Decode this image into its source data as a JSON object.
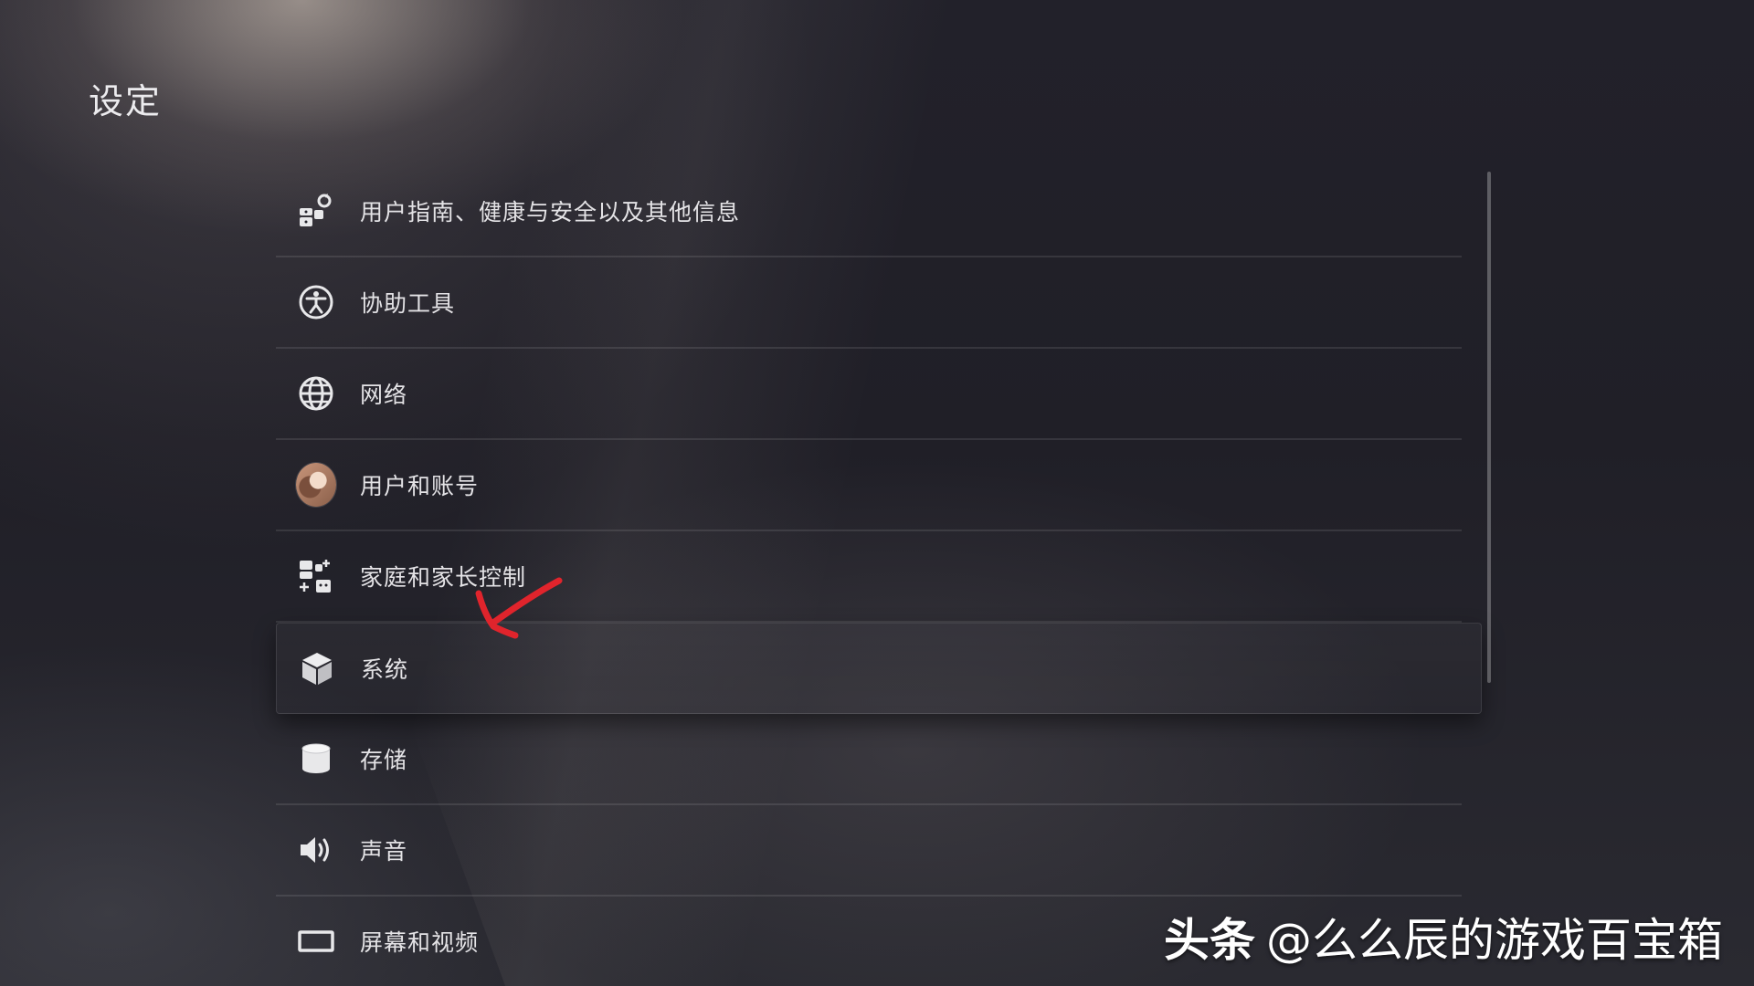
{
  "page": {
    "title": "设定"
  },
  "menu": {
    "items": [
      {
        "label": "用户指南、健康与安全以及其他信息",
        "icon": "user-guide-icon"
      },
      {
        "label": "协助工具",
        "icon": "accessibility-icon"
      },
      {
        "label": "网络",
        "icon": "globe-icon"
      },
      {
        "label": "用户和账号",
        "icon": "avatar"
      },
      {
        "label": "家庭和家长控制",
        "icon": "family-icon"
      },
      {
        "label": "系统",
        "icon": "cube-icon",
        "focused": true
      },
      {
        "label": "存储",
        "icon": "storage-icon"
      },
      {
        "label": "声音",
        "icon": "speaker-icon"
      },
      {
        "label": "屏幕和视频",
        "icon": "screen-icon"
      }
    ]
  },
  "annotation": {
    "arrow_color": "#e0242c"
  },
  "watermark": {
    "brand": "头条",
    "handle": "@么么辰的游戏百宝箱"
  }
}
